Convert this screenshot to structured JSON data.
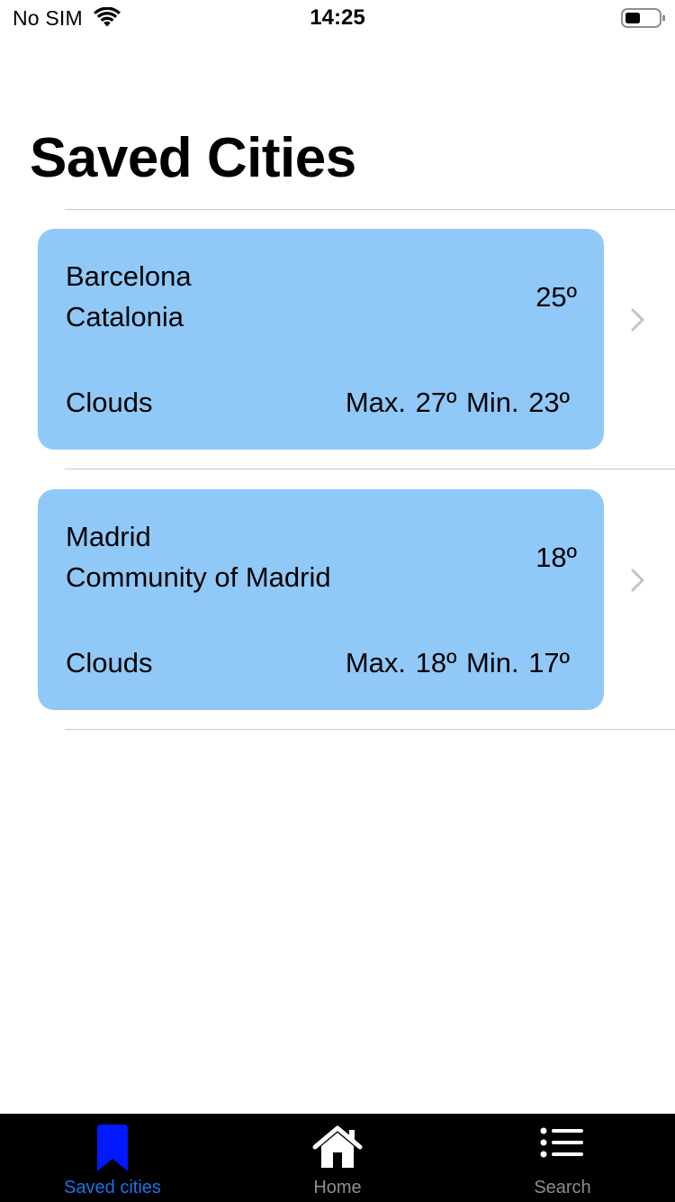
{
  "status_bar": {
    "carrier": "No SIM",
    "time": "14:25",
    "wifi_icon": "wifi-icon",
    "battery_icon": "battery-icon"
  },
  "page": {
    "title": "Saved Cities"
  },
  "cities": [
    {
      "name": "Barcelona",
      "region": "Catalonia",
      "temperature": "25º",
      "weather": "Clouds",
      "minmax": "Max. 27º  Min. 23º"
    },
    {
      "name": "Madrid",
      "region": "Community of Madrid",
      "temperature": "18º",
      "weather": "Clouds",
      "minmax": "Max. 18º  Min. 17º"
    }
  ],
  "tab_bar": {
    "tabs": [
      {
        "label": "Saved cities",
        "icon": "bookmark-icon",
        "active": true
      },
      {
        "label": "Home",
        "icon": "home-icon",
        "active": false
      },
      {
        "label": "Search",
        "icon": "list-icon",
        "active": false
      }
    ]
  },
  "colors": {
    "card_background": "#90c9f8",
    "active_tab": "#1a73e8",
    "active_icon": "#0019ff",
    "tab_bar_background": "#000000"
  }
}
